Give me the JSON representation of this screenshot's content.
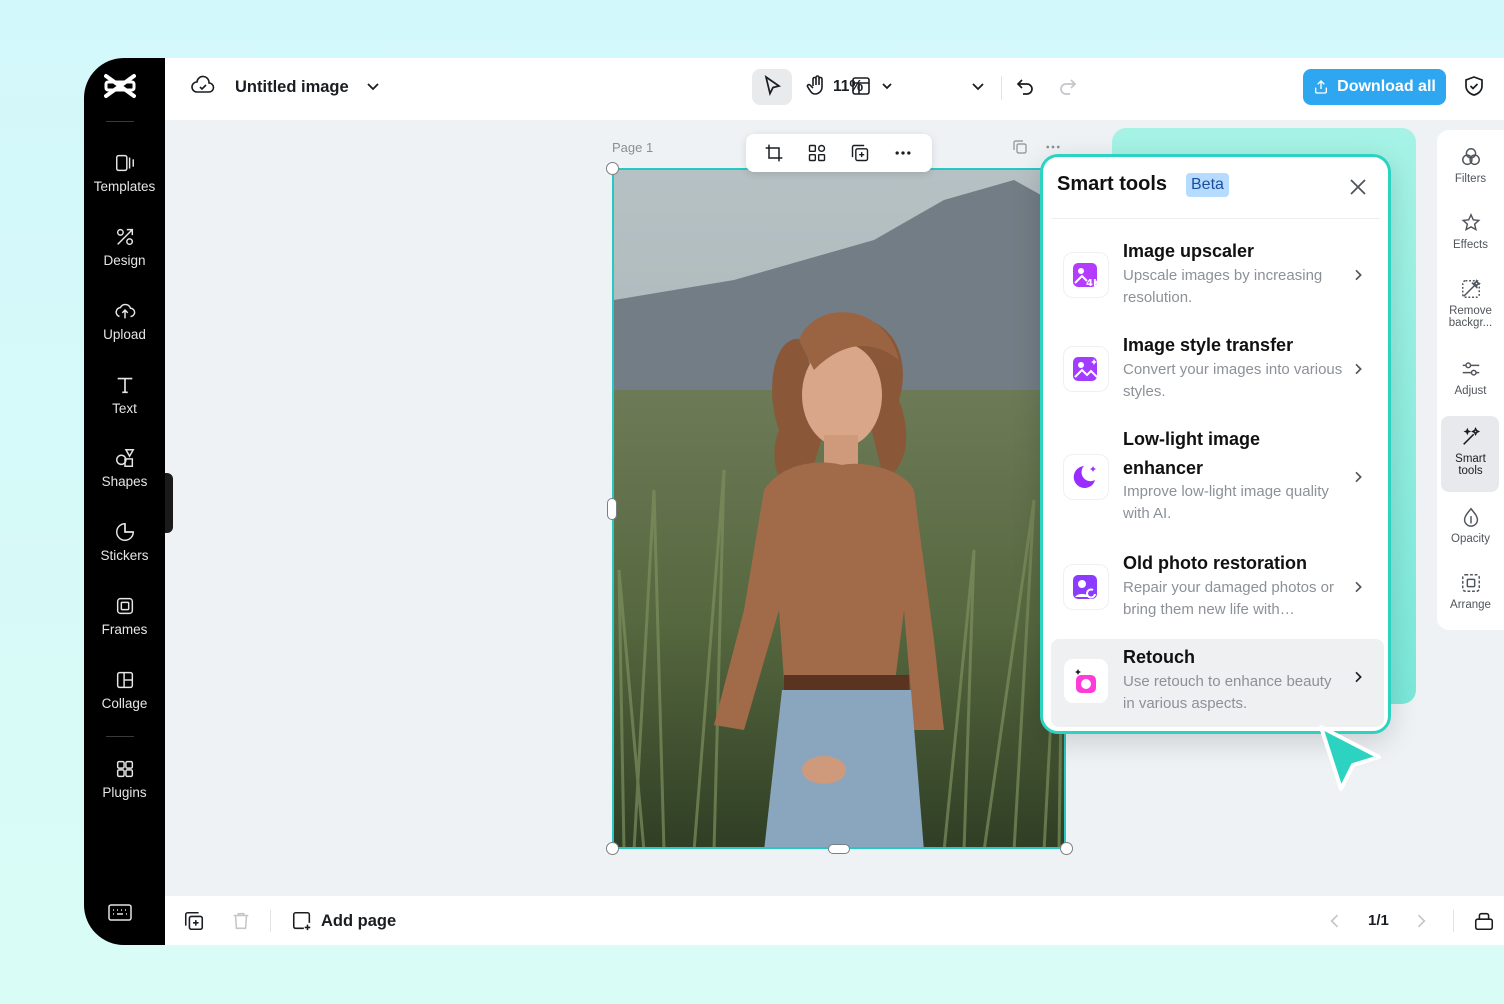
{
  "sidebar": {
    "items": [
      {
        "label": "Templates",
        "icon": "templates-icon"
      },
      {
        "label": "Design",
        "icon": "design-icon"
      },
      {
        "label": "Upload",
        "icon": "upload-icon"
      },
      {
        "label": "Text",
        "icon": "text-icon"
      },
      {
        "label": "Shapes",
        "icon": "shapes-icon"
      },
      {
        "label": "Stickers",
        "icon": "stickers-icon"
      },
      {
        "label": "Frames",
        "icon": "frames-icon"
      },
      {
        "label": "Collage",
        "icon": "collage-icon"
      },
      {
        "label": "Plugins",
        "icon": "plugins-icon"
      }
    ]
  },
  "header": {
    "title": "Untitled image",
    "zoom": "11%",
    "download_label": "Download all"
  },
  "canvas": {
    "page_label": "Page 1"
  },
  "footer": {
    "add_page_label": "Add page",
    "page_count": "1/1"
  },
  "rail": {
    "items": [
      {
        "label": "Filters",
        "icon": "filters-icon"
      },
      {
        "label": "Effects",
        "icon": "effects-icon"
      },
      {
        "label": "Remove backgr...",
        "icon": "remove-background-icon"
      },
      {
        "label": "Adjust",
        "icon": "adjust-icon"
      },
      {
        "label": "Smart tools",
        "icon": "smart-tools-icon"
      },
      {
        "label": "Opacity",
        "icon": "opacity-icon"
      },
      {
        "label": "Arrange",
        "icon": "arrange-icon"
      }
    ]
  },
  "panel": {
    "title": "Smart tools",
    "badge": "Beta",
    "tools": [
      {
        "name": "Image upscaler",
        "desc": "Upscale images by increasing resolution."
      },
      {
        "name": "Image style transfer",
        "desc": "Convert your images into various styles."
      },
      {
        "name": "Low-light image enhancer",
        "desc": "Improve low-light image quality with AI."
      },
      {
        "name": "Old photo restoration",
        "desc": "Repair your damaged photos or bring them new life with…"
      },
      {
        "name": "Retouch",
        "desc": "Use retouch to enhance beauty in various aspects."
      }
    ]
  },
  "colors": {
    "accent": "#2cd3c1",
    "download": "#2fa6f0",
    "icon_gradient_start": "#c13bff",
    "icon_gradient_end": "#6a3cff"
  }
}
